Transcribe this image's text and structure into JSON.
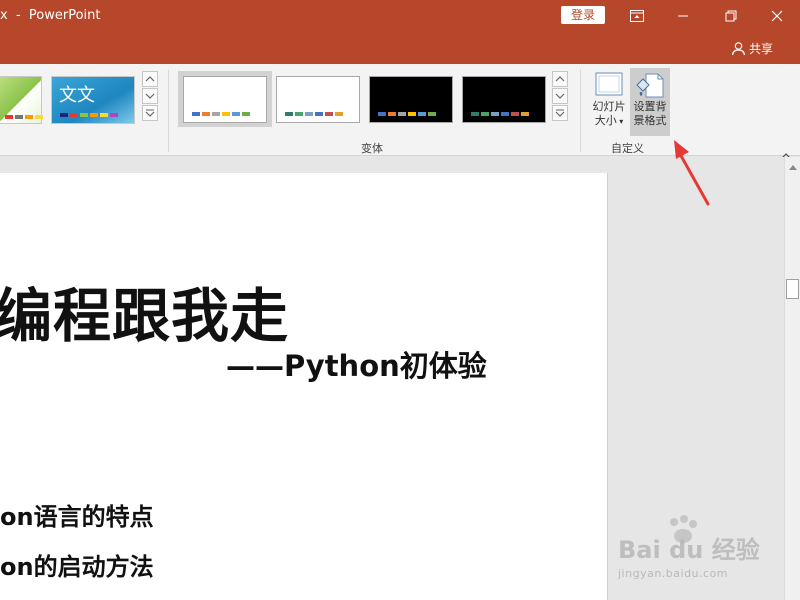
{
  "titlebar": {
    "title": "x  -  PowerPoint",
    "login_label": "登录"
  },
  "sharebar": {
    "share_label": "共享"
  },
  "ribbon": {
    "themes": [
      {
        "name": "green-theme",
        "swatches": [
          "#8bc34a",
          "#e53935",
          "#757575",
          "#ff9800",
          "#fdd835"
        ]
      },
      {
        "name": "blue-theme",
        "word": "文文",
        "swatches": [
          "#1a237e",
          "#e53935",
          "#8bc34a",
          "#ff9800",
          "#fdd835",
          "#ab47bc"
        ]
      }
    ],
    "variants_label": "变体",
    "variants": [
      {
        "bg": "#ffffff",
        "swatches": [
          "#4472c4",
          "#ed7d31",
          "#a5a5a5",
          "#ffc000",
          "#5b9bd5",
          "#70ad47"
        ]
      },
      {
        "bg": "#ffffff",
        "swatches": [
          "#2e7d6b",
          "#4aa36c",
          "#7aa0c4",
          "#4472c4",
          "#c0504d",
          "#e0a030"
        ]
      },
      {
        "bg": "#000000",
        "swatches": [
          "#4472c4",
          "#ed7d31",
          "#a5a5a5",
          "#ffc000",
          "#5b9bd5",
          "#70ad47"
        ]
      },
      {
        "bg": "#000000",
        "swatches": [
          "#2e7d6b",
          "#4aa36c",
          "#7aa0c4",
          "#4472c4",
          "#c0504d",
          "#e0a030"
        ]
      }
    ],
    "customize_label": "自定义",
    "slide_size_line1": "幻灯片",
    "slide_size_line2": "大小",
    "format_bg_line1": "设置背",
    "format_bg_line2": "景格式"
  },
  "slide": {
    "title": "编程跟我走",
    "subtitle": "——Python初体验",
    "bullets": [
      "on语言的特点",
      "on的启动方法"
    ]
  },
  "watermark": {
    "brand": "Bai du 经验",
    "url": "jingyan.baidu.com"
  },
  "colors": {
    "accent": "#b7472a",
    "annotation_arrow": "#e53935"
  }
}
